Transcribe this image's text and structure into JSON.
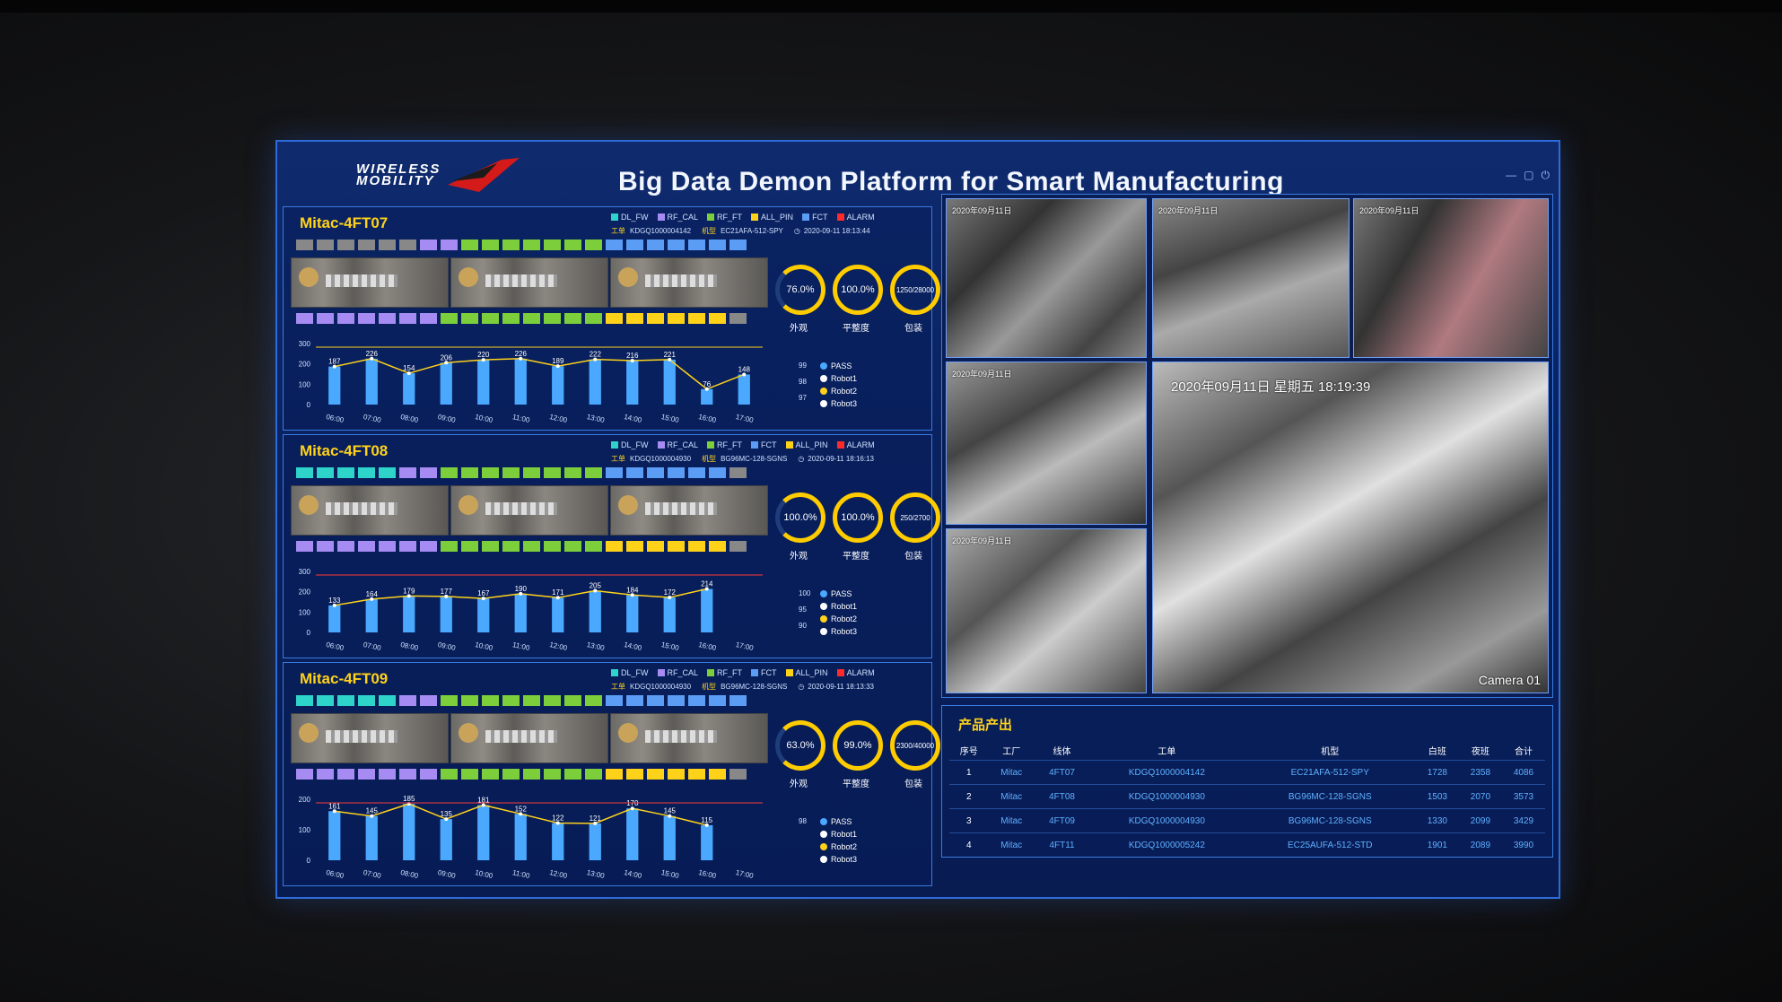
{
  "header": {
    "logo_text_1": "WIRELESS",
    "logo_text_2": "MOBILITY",
    "title": "Big Data Demon Platform for Smart Manufacturing"
  },
  "legend_set_a": [
    "DL_FW",
    "RF_CAL",
    "RF_FT",
    "ALL_PIN",
    "FCT",
    "ALARM"
  ],
  "legend_set_b": [
    "DL_FW",
    "RF_CAL",
    "RF_FT",
    "FCT",
    "ALL_PIN",
    "ALARM"
  ],
  "colors": {
    "DL_FW": "#2ed4c9",
    "RF_CAL": "#a68cf2",
    "RF_FT": "#7ccf3a",
    "ALL_PIN": "#ffd21a",
    "FCT": "#5b9cf5",
    "ALARM": "#ff2a2a",
    "PASS": "#4aa8ff",
    "Robot1": "#ffffff",
    "Robot2": "#ffd21a",
    "Robot3": "#ffffff"
  },
  "gauge_labels": [
    "外观",
    "平整度",
    "包装"
  ],
  "chart_legend": [
    "PASS",
    "Robot1",
    "Robot2",
    "Robot3"
  ],
  "meta_labels": {
    "order": "工单",
    "model": "机型"
  },
  "lines": [
    {
      "name": "Mitac-4FT07",
      "order": "KDGQ1000004142",
      "model": "EC21AFA-512-SPY",
      "time": "2020-09-11 18:13:44",
      "legend": "a",
      "gauges": [
        "76.0%",
        "100.0%",
        "1250/28000"
      ],
      "right_vals": [
        "99",
        "98",
        "97"
      ],
      "chart_data": {
        "type": "bar",
        "categories": [
          "06:00",
          "07:00",
          "08:00",
          "09:00",
          "10:00",
          "11:00",
          "12:00",
          "13:00",
          "14:00",
          "15:00",
          "16:00",
          "17:00"
        ],
        "values": [
          187,
          226,
          154,
          206,
          220,
          226,
          189,
          222,
          216,
          221,
          76,
          148
        ],
        "ylim": [
          0,
          300
        ],
        "yticks": [
          "300",
          "200",
          "100",
          "0"
        ]
      }
    },
    {
      "name": "Mitac-4FT08",
      "order": "KDGQ1000004930",
      "model": "BG96MC-128-SGNS",
      "time": "2020-09-11 18:16:13",
      "legend": "b",
      "gauges": [
        "100.0%",
        "100.0%",
        "250/2700"
      ],
      "right_vals": [
        "100",
        "95",
        "90"
      ],
      "chart_data": {
        "type": "bar",
        "categories": [
          "06:00",
          "07:00",
          "08:00",
          "09:00",
          "10:00",
          "11:00",
          "12:00",
          "13:00",
          "14:00",
          "15:00",
          "16:00",
          "17:00"
        ],
        "values": [
          133,
          164,
          179,
          177,
          167,
          190,
          171,
          205,
          184,
          172,
          214
        ],
        "ylim": [
          0,
          300
        ],
        "yticks": [
          "300",
          "200",
          "100",
          "0"
        ]
      }
    },
    {
      "name": "Mitac-4FT09",
      "order": "KDGQ1000004930",
      "model": "BG96MC-128-SGNS",
      "time": "2020-09-11 18:13:33",
      "legend": "b",
      "gauges": [
        "63.0%",
        "99.0%",
        "2300/40000"
      ],
      "right_vals": [
        "98",
        "",
        ""
      ],
      "chart_data": {
        "type": "bar",
        "categories": [
          "06:00",
          "07:00",
          "08:00",
          "09:00",
          "10:00",
          "11:00",
          "12:00",
          "13:00",
          "14:00",
          "15:00",
          "16:00",
          "17:00"
        ],
        "values": [
          161,
          145,
          185,
          135,
          181,
          152,
          122,
          121,
          170,
          145,
          115
        ],
        "ylim": [
          0,
          200
        ],
        "yticks": [
          "200",
          "100",
          "0"
        ]
      }
    }
  ],
  "cameras": {
    "ts_1": "2020年09月11日",
    "ts_2": "2020年09月11日",
    "ts_3": "2020年09月11日",
    "ts_4": "2020年09月11日",
    "ts_5": "2020年09月11日",
    "big_ts": "2020年09月11日 星期五 18:19:39",
    "big_label": "Camera 01"
  },
  "product": {
    "title": "产品产出",
    "headers": [
      "序号",
      "工厂",
      "线体",
      "工单",
      "机型",
      "白班",
      "夜班",
      "合计"
    ],
    "rows": [
      [
        "1",
        "Mitac",
        "4FT07",
        "KDGQ1000004142",
        "EC21AFA-512-SPY",
        "1728",
        "2358",
        "4086"
      ],
      [
        "2",
        "Mitac",
        "4FT08",
        "KDGQ1000004930",
        "BG96MC-128-SGNS",
        "1503",
        "2070",
        "3573"
      ],
      [
        "3",
        "Mitac",
        "4FT09",
        "KDGQ1000004930",
        "BG96MC-128-SGNS",
        "1330",
        "2099",
        "3429"
      ],
      [
        "4",
        "Mitac",
        "4FT11",
        "KDGQ1000005242",
        "EC25AUFA-512-STD",
        "1901",
        "2089",
        "3990"
      ]
    ]
  }
}
